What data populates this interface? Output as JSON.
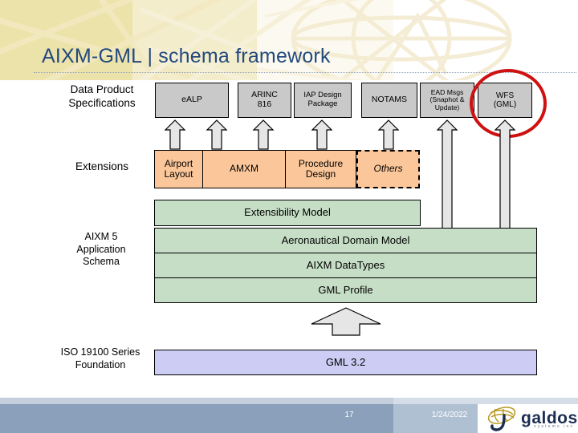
{
  "slide": {
    "title": "AIXM-GML | schema framework",
    "title_color": "#23497d"
  },
  "rows": {
    "data_product_specifications": {
      "label": "Data Product\nSpecifications",
      "label_line1": "Data Product",
      "label_line2": "Specifications",
      "fill_color": "#c9c9c9",
      "boxes": [
        {
          "label": "eALP"
        },
        {
          "label_line1": "ARINC",
          "label_line2": "816"
        },
        {
          "label_line1": "IAP Design",
          "label_line2": "Package"
        },
        {
          "label": "NOTAMS"
        },
        {
          "label_line1": "EAD Msgs",
          "label_line2": "(Snaphot &",
          "label_line3": "Update)"
        },
        {
          "label_line1": "WFS",
          "label_line2": "(GML)",
          "highlighted": true
        }
      ]
    },
    "extensions": {
      "label": "Extensions",
      "fill_color": "#fbc79a",
      "boxes": [
        {
          "label_line1": "Airport",
          "label_line2": "Layout",
          "style": "solid"
        },
        {
          "label": "AMXM",
          "style": "solid"
        },
        {
          "label_line1": "Procedure",
          "label_line2": "Design",
          "style": "solid"
        },
        {
          "label": "Others",
          "style": "dashed-italic"
        }
      ]
    },
    "aixm_application_schema": {
      "label_line1": "AIXM 5",
      "label_line2": "Application",
      "label_line3": "Schema",
      "fill_color": "#c6dec6",
      "bands": [
        {
          "label": "Extensibility Model",
          "width": "narrow"
        },
        {
          "label": "Aeronautical Domain Model",
          "width": "full"
        },
        {
          "label": "AIXM DataTypes",
          "width": "full"
        },
        {
          "label": "GML Profile",
          "width": "full"
        }
      ]
    },
    "iso_foundation": {
      "label_line1": "ISO 19100 Series",
      "label_line2": "Foundation",
      "fill_color": "#ccccf4",
      "bands": [
        {
          "label": "GML 3.2"
        }
      ]
    }
  },
  "highlight": {
    "color": "#cf1111",
    "target": "WFS (GML)"
  },
  "footer": {
    "slide_number": "17",
    "date": "1/24/2022",
    "logo_word": "galdos",
    "logo_tagline": "systems inc",
    "bar_color": "#8ba1bb"
  }
}
